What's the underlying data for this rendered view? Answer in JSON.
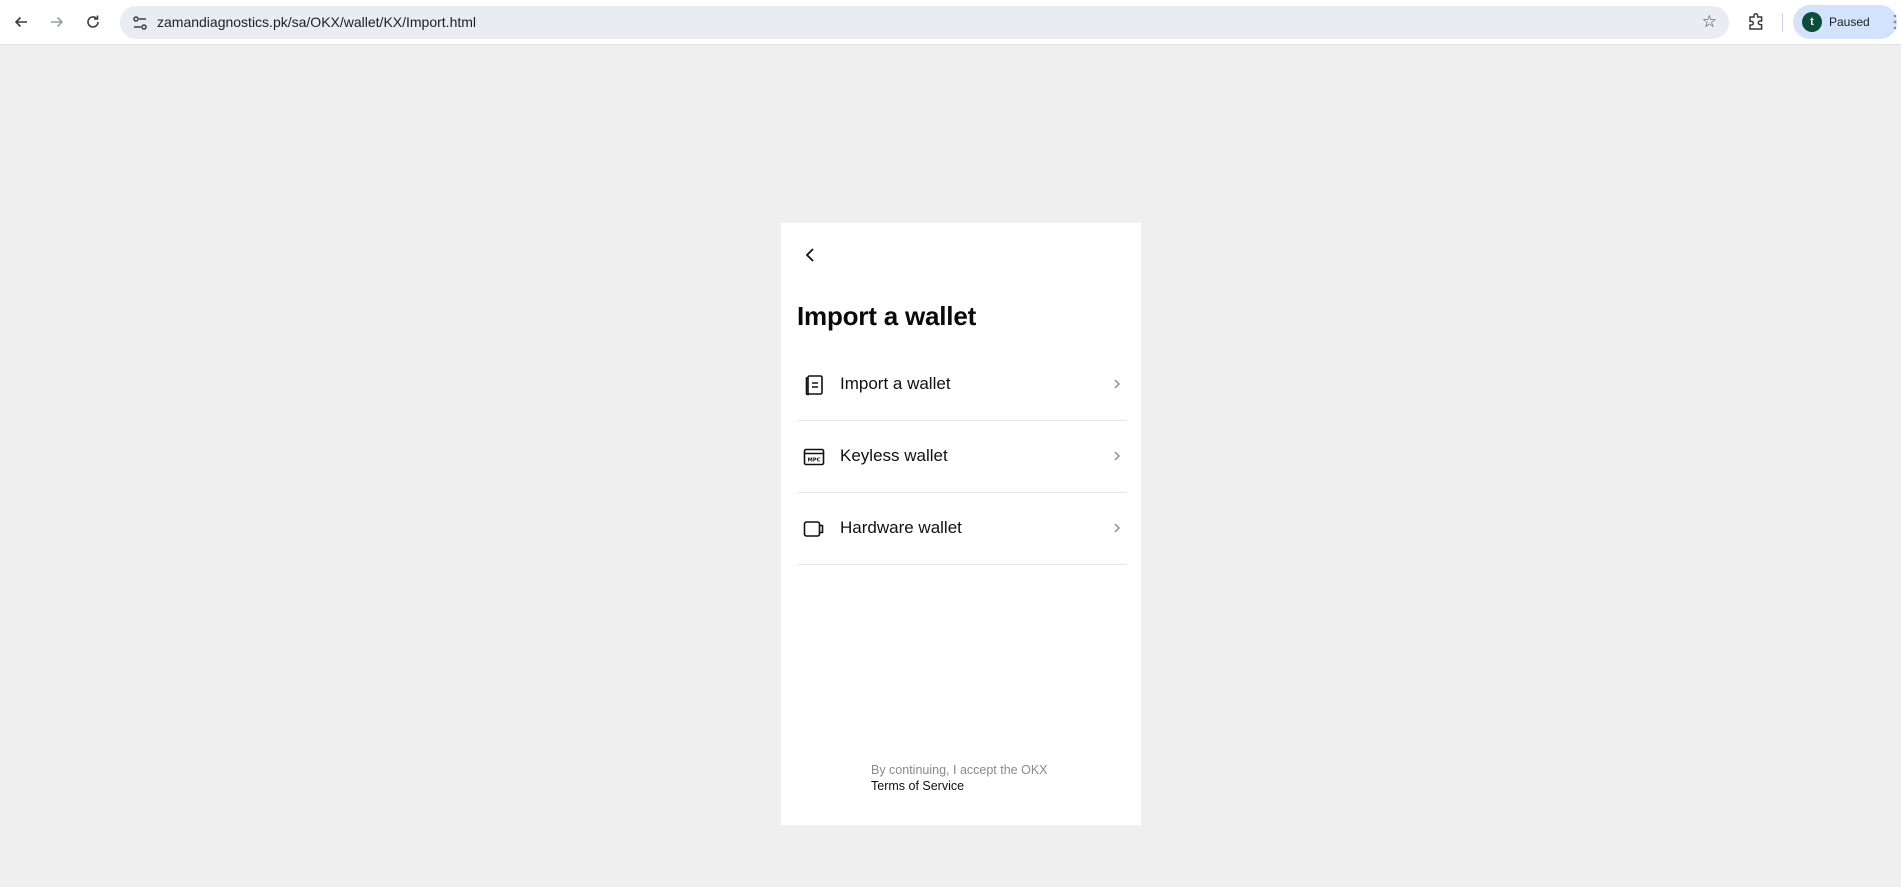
{
  "browser": {
    "url": "zamandiagnostics.pk/sa/OKX/wallet/KX/Import.html",
    "profile_initial": "t",
    "profile_status": "Paused",
    "icons": {
      "back": "arrow-left-icon",
      "forward": "arrow-right-icon",
      "reload": "reload-icon",
      "site_info": "tune-icon",
      "bookmark": "star-icon",
      "extensions": "puzzle-icon",
      "menu": "kebab-menu-icon"
    }
  },
  "page": {
    "title": "Import a wallet",
    "back_icon": "chevron-left-icon",
    "options": [
      {
        "label": "Import a wallet",
        "icon": "notebook-icon"
      },
      {
        "label": "Keyless wallet",
        "icon": "mpc-card-icon"
      },
      {
        "label": "Hardware wallet",
        "icon": "hardware-device-icon"
      }
    ],
    "footer": {
      "prefix": "By continuing, I accept the OKX",
      "link": "Terms of Service"
    }
  }
}
